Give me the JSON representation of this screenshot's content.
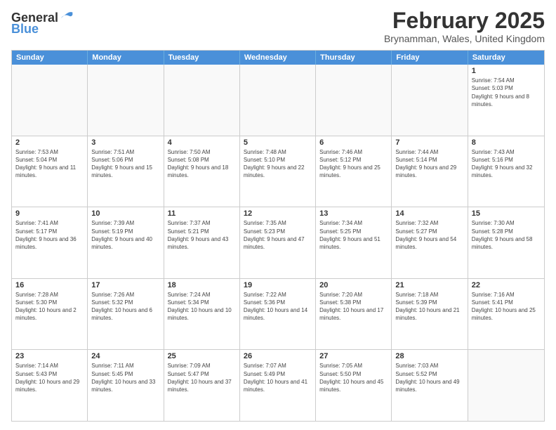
{
  "logo": {
    "general": "General",
    "blue": "Blue"
  },
  "title": "February 2025",
  "subtitle": "Brynamman, Wales, United Kingdom",
  "header_days": [
    "Sunday",
    "Monday",
    "Tuesday",
    "Wednesday",
    "Thursday",
    "Friday",
    "Saturday"
  ],
  "weeks": [
    [
      {
        "day": "",
        "info": ""
      },
      {
        "day": "",
        "info": ""
      },
      {
        "day": "",
        "info": ""
      },
      {
        "day": "",
        "info": ""
      },
      {
        "day": "",
        "info": ""
      },
      {
        "day": "",
        "info": ""
      },
      {
        "day": "1",
        "info": "Sunrise: 7:54 AM\nSunset: 5:03 PM\nDaylight: 9 hours and 8 minutes."
      }
    ],
    [
      {
        "day": "2",
        "info": "Sunrise: 7:53 AM\nSunset: 5:04 PM\nDaylight: 9 hours and 11 minutes."
      },
      {
        "day": "3",
        "info": "Sunrise: 7:51 AM\nSunset: 5:06 PM\nDaylight: 9 hours and 15 minutes."
      },
      {
        "day": "4",
        "info": "Sunrise: 7:50 AM\nSunset: 5:08 PM\nDaylight: 9 hours and 18 minutes."
      },
      {
        "day": "5",
        "info": "Sunrise: 7:48 AM\nSunset: 5:10 PM\nDaylight: 9 hours and 22 minutes."
      },
      {
        "day": "6",
        "info": "Sunrise: 7:46 AM\nSunset: 5:12 PM\nDaylight: 9 hours and 25 minutes."
      },
      {
        "day": "7",
        "info": "Sunrise: 7:44 AM\nSunset: 5:14 PM\nDaylight: 9 hours and 29 minutes."
      },
      {
        "day": "8",
        "info": "Sunrise: 7:43 AM\nSunset: 5:16 PM\nDaylight: 9 hours and 32 minutes."
      }
    ],
    [
      {
        "day": "9",
        "info": "Sunrise: 7:41 AM\nSunset: 5:17 PM\nDaylight: 9 hours and 36 minutes."
      },
      {
        "day": "10",
        "info": "Sunrise: 7:39 AM\nSunset: 5:19 PM\nDaylight: 9 hours and 40 minutes."
      },
      {
        "day": "11",
        "info": "Sunrise: 7:37 AM\nSunset: 5:21 PM\nDaylight: 9 hours and 43 minutes."
      },
      {
        "day": "12",
        "info": "Sunrise: 7:35 AM\nSunset: 5:23 PM\nDaylight: 9 hours and 47 minutes."
      },
      {
        "day": "13",
        "info": "Sunrise: 7:34 AM\nSunset: 5:25 PM\nDaylight: 9 hours and 51 minutes."
      },
      {
        "day": "14",
        "info": "Sunrise: 7:32 AM\nSunset: 5:27 PM\nDaylight: 9 hours and 54 minutes."
      },
      {
        "day": "15",
        "info": "Sunrise: 7:30 AM\nSunset: 5:28 PM\nDaylight: 9 hours and 58 minutes."
      }
    ],
    [
      {
        "day": "16",
        "info": "Sunrise: 7:28 AM\nSunset: 5:30 PM\nDaylight: 10 hours and 2 minutes."
      },
      {
        "day": "17",
        "info": "Sunrise: 7:26 AM\nSunset: 5:32 PM\nDaylight: 10 hours and 6 minutes."
      },
      {
        "day": "18",
        "info": "Sunrise: 7:24 AM\nSunset: 5:34 PM\nDaylight: 10 hours and 10 minutes."
      },
      {
        "day": "19",
        "info": "Sunrise: 7:22 AM\nSunset: 5:36 PM\nDaylight: 10 hours and 14 minutes."
      },
      {
        "day": "20",
        "info": "Sunrise: 7:20 AM\nSunset: 5:38 PM\nDaylight: 10 hours and 17 minutes."
      },
      {
        "day": "21",
        "info": "Sunrise: 7:18 AM\nSunset: 5:39 PM\nDaylight: 10 hours and 21 minutes."
      },
      {
        "day": "22",
        "info": "Sunrise: 7:16 AM\nSunset: 5:41 PM\nDaylight: 10 hours and 25 minutes."
      }
    ],
    [
      {
        "day": "23",
        "info": "Sunrise: 7:14 AM\nSunset: 5:43 PM\nDaylight: 10 hours and 29 minutes."
      },
      {
        "day": "24",
        "info": "Sunrise: 7:11 AM\nSunset: 5:45 PM\nDaylight: 10 hours and 33 minutes."
      },
      {
        "day": "25",
        "info": "Sunrise: 7:09 AM\nSunset: 5:47 PM\nDaylight: 10 hours and 37 minutes."
      },
      {
        "day": "26",
        "info": "Sunrise: 7:07 AM\nSunset: 5:49 PM\nDaylight: 10 hours and 41 minutes."
      },
      {
        "day": "27",
        "info": "Sunrise: 7:05 AM\nSunset: 5:50 PM\nDaylight: 10 hours and 45 minutes."
      },
      {
        "day": "28",
        "info": "Sunrise: 7:03 AM\nSunset: 5:52 PM\nDaylight: 10 hours and 49 minutes."
      },
      {
        "day": "",
        "info": ""
      }
    ]
  ]
}
